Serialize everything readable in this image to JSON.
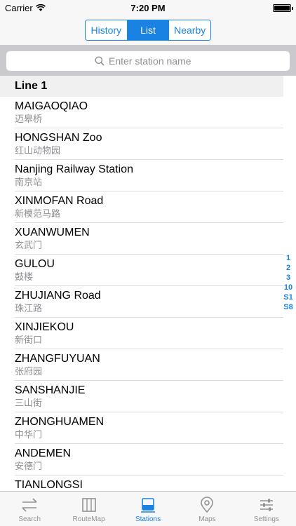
{
  "status_bar": {
    "carrier": "Carrier",
    "time": "7:20 PM"
  },
  "segments": [
    {
      "label": "History",
      "active": false
    },
    {
      "label": "List",
      "active": true
    },
    {
      "label": "Nearby",
      "active": false
    }
  ],
  "search": {
    "placeholder": "Enter station name"
  },
  "section": {
    "title": "Line 1"
  },
  "stations": [
    {
      "en": "MAIGAOQIAO",
      "cn": "迈皋桥"
    },
    {
      "en": "HONGSHAN Zoo",
      "cn": "红山动物园"
    },
    {
      "en": "Nanjing Railway Station",
      "cn": "南京站"
    },
    {
      "en": "XINMOFAN Road",
      "cn": "新模范马路"
    },
    {
      "en": "XUANWUMEN",
      "cn": "玄武门"
    },
    {
      "en": "GULOU",
      "cn": "鼓楼"
    },
    {
      "en": "ZHUJIANG Road",
      "cn": "珠江路"
    },
    {
      "en": "XINJIEKOU",
      "cn": "新街口"
    },
    {
      "en": "ZHANGFUYUAN",
      "cn": "张府园"
    },
    {
      "en": "SANSHANJIE",
      "cn": "三山街"
    },
    {
      "en": "ZHONGHUAMEN",
      "cn": "中华门"
    },
    {
      "en": "ANDEMEN",
      "cn": "安德门"
    },
    {
      "en": "TIANLONGSI",
      "cn": ""
    }
  ],
  "section_index": [
    "1",
    "2",
    "3",
    "10",
    "S1",
    "S8"
  ],
  "tabs": [
    {
      "label": "Search",
      "icon": "swap-arrows-icon",
      "active": false
    },
    {
      "label": "RouteMap",
      "icon": "map-book-icon",
      "active": false
    },
    {
      "label": "Stations",
      "icon": "stations-list-icon",
      "active": true
    },
    {
      "label": "Maps",
      "icon": "location-pin-icon",
      "active": false
    },
    {
      "label": "Settings",
      "icon": "sliders-icon",
      "active": false
    }
  ],
  "colors": {
    "accent": "#1a82e2",
    "inactive_tab": "#929292",
    "subtitle": "#8e8e93"
  }
}
